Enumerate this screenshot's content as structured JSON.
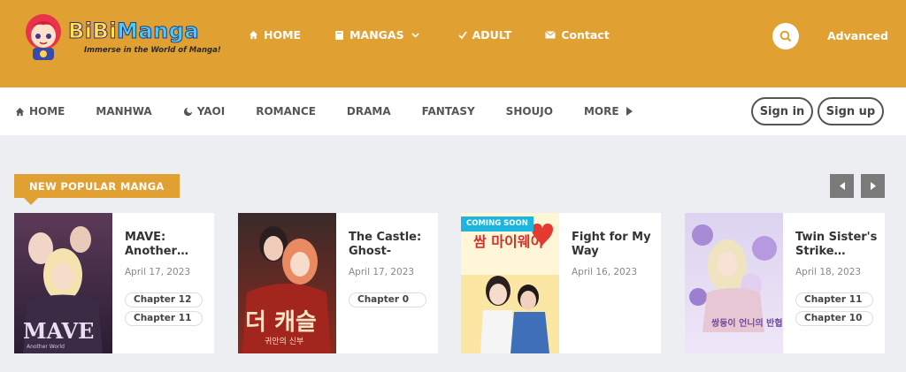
{
  "header": {
    "logo_text_a": "BiBi",
    "logo_text_b": "Manga",
    "tagline": "Immerse in the World of Manga!",
    "nav": [
      {
        "label": "HOME",
        "icon": "home-icon"
      },
      {
        "label": "MANGAS",
        "icon": "book-icon"
      },
      {
        "label": "ADULT",
        "icon": "check-icon"
      },
      {
        "label": "Contact",
        "icon": "envelope-icon"
      }
    ],
    "advanced_label": "Advanced"
  },
  "subnav": {
    "items": [
      {
        "label": "HOME",
        "icon": "home-icon"
      },
      {
        "label": "MANHWA"
      },
      {
        "label": "YAOI",
        "icon": "moon-icon"
      },
      {
        "label": "ROMANCE"
      },
      {
        "label": "DRAMA"
      },
      {
        "label": "FANTASY"
      },
      {
        "label": "SHOUJO"
      },
      {
        "label": "MORE",
        "icon": "caret-right-icon"
      }
    ],
    "signin_label": "Sign in",
    "signup_label": "Sign up"
  },
  "section": {
    "title": "NEW POPULAR MANGA"
  },
  "cards": [
    {
      "title": "MAVE: Another…",
      "date": "April 17, 2023",
      "chapters": [
        "Chapter 12",
        "Chapter 11"
      ],
      "cover_text": "MAVE",
      "cover_subtext": "Another World"
    },
    {
      "title": "The Castle: Ghost-eyed…",
      "date": "April 17, 2023",
      "chapters": [
        "Chapter 0"
      ],
      "cover_text": "더 캐슬",
      "cover_subtext": "귀안의 신부"
    },
    {
      "title": "Fight for My Way",
      "date": "April 16, 2023",
      "chapters": [],
      "badge": "COMING SOON",
      "cover_text": "쌈 마이웨이"
    },
    {
      "title": "Twin Sister's Strike…",
      "date": "April 18, 2023",
      "chapters": [
        "Chapter 11",
        "Chapter 10"
      ],
      "cover_text": "쌍둥이 언니의 반협신인"
    }
  ],
  "colors": {
    "brand": "#e1a032",
    "badge": "#1cb5e0"
  }
}
